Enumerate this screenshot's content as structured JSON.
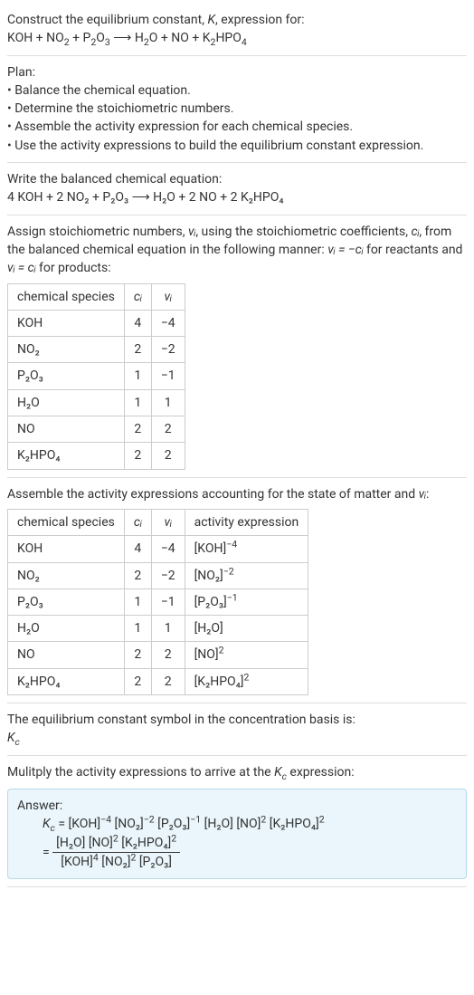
{
  "intro": {
    "line1": "Construct the equilibrium constant, ",
    "Kital": "K",
    "line1b": ", expression for:",
    "eq_left": "KOH + NO",
    "eq_left2": " + P",
    "eq_left3": "O",
    "arrow": " ⟶ ",
    "eq_right1": "H",
    "eq_right2": "O + NO + K",
    "eq_right3": "HPO"
  },
  "plan": {
    "title": "Plan:",
    "b1": "• Balance the chemical equation.",
    "b2": "• Determine the stoichiometric numbers.",
    "b3": "• Assemble the activity expression for each chemical species.",
    "b4": "• Use the activity expressions to build the equilibrium constant expression."
  },
  "balanced": {
    "title": "Write the balanced chemical equation:",
    "eq": "4 KOH + 2 NO₂ + P₂O₃  ⟶  H₂O + 2 NO + 2 K₂HPO₄"
  },
  "assign": {
    "text1": "Assign stoichiometric numbers, ",
    "nu": "νᵢ",
    "text2": ", using the stoichiometric coefficients, ",
    "ci": "cᵢ",
    "text3": ", from the balanced chemical equation in the following manner: ",
    "rel1": "νᵢ = −cᵢ",
    "text4": " for reactants and ",
    "rel2": "νᵢ = cᵢ",
    "text5": " for products:"
  },
  "table1": {
    "h1": "chemical species",
    "h2": "cᵢ",
    "h3": "νᵢ",
    "rows": [
      {
        "sp": "KOH",
        "c": "4",
        "n": "−4"
      },
      {
        "sp": "NO₂",
        "c": "2",
        "n": "−2"
      },
      {
        "sp": "P₂O₃",
        "c": "1",
        "n": "−1"
      },
      {
        "sp": "H₂O",
        "c": "1",
        "n": "1"
      },
      {
        "sp": "NO",
        "c": "2",
        "n": "2"
      },
      {
        "sp": "K₂HPO₄",
        "c": "2",
        "n": "2"
      }
    ]
  },
  "assemble": {
    "text1": "Assemble the activity expressions accounting for the state of matter and ",
    "nu": "νᵢ",
    "text2": ":"
  },
  "table2": {
    "h1": "chemical species",
    "h2": "cᵢ",
    "h3": "νᵢ",
    "h4": "activity expression",
    "rows": [
      {
        "sp": "KOH",
        "c": "4",
        "n": "−4",
        "a_base": "[KOH]",
        "a_exp": "−4"
      },
      {
        "sp": "NO₂",
        "c": "2",
        "n": "−2",
        "a_base": "[NO₂]",
        "a_exp": "−2"
      },
      {
        "sp": "P₂O₃",
        "c": "1",
        "n": "−1",
        "a_base": "[P₂O₃]",
        "a_exp": "−1"
      },
      {
        "sp": "H₂O",
        "c": "1",
        "n": "1",
        "a_base": "[H₂O]",
        "a_exp": ""
      },
      {
        "sp": "NO",
        "c": "2",
        "n": "2",
        "a_base": "[NO]",
        "a_exp": "2"
      },
      {
        "sp": "K₂HPO₄",
        "c": "2",
        "n": "2",
        "a_base": "[K₂HPO₄]",
        "a_exp": "2"
      }
    ]
  },
  "symbol": {
    "line1": "The equilibrium constant symbol in the concentration basis is:",
    "Kc_K": "K",
    "Kc_c": "c"
  },
  "multiply": {
    "line": "Mulitply the activity expressions to arrive at the ",
    "Kc_K": "K",
    "Kc_c": "c",
    "line2": " expression:"
  },
  "answer": {
    "label": "Answer:",
    "Kc_K": "K",
    "Kc_c": "c",
    "eq_sign": " = ",
    "prod": {
      "p1_base": "[KOH]",
      "p1_exp": "−4",
      "p2_base": "[NO₂]",
      "p2_exp": "−2",
      "p3_base": "[P₂O₃]",
      "p3_exp": "−1",
      "p4_base": "[H₂O]",
      "p4_exp": "",
      "p5_base": "[NO]",
      "p5_exp": "2",
      "p6_base": "[K₂HPO₄]",
      "p6_exp": "2"
    },
    "frac": {
      "num": {
        "a": "[H₂O]",
        "b_base": "[NO]",
        "b_exp": "2",
        "c_base": "[K₂HPO₄]",
        "c_exp": "2"
      },
      "den": {
        "a_base": "[KOH]",
        "a_exp": "4",
        "b_base": "[NO₂]",
        "b_exp": "2",
        "c": "[P₂O₃]"
      }
    }
  }
}
